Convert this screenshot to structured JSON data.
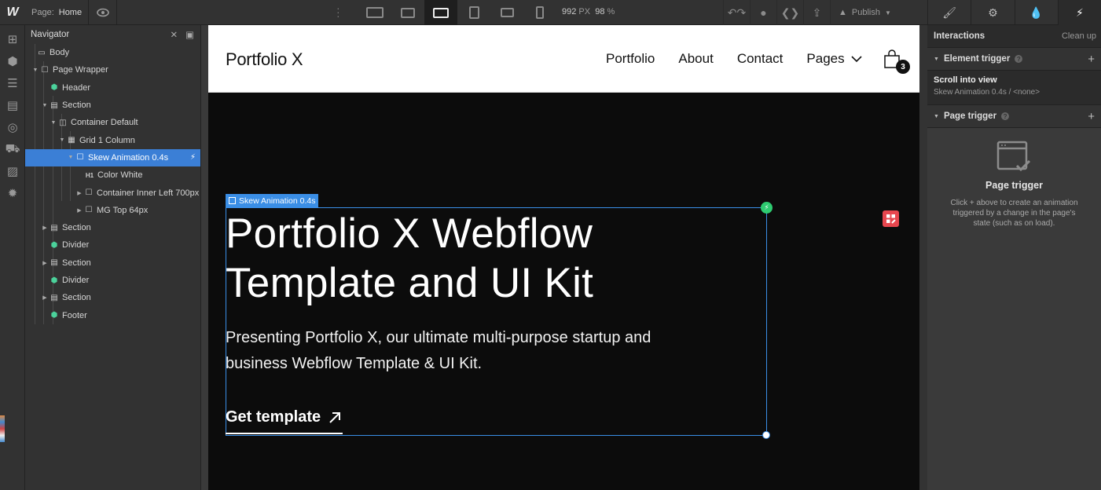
{
  "topbar": {
    "logo": "W",
    "page_label": "Page:",
    "page_name": "Home",
    "width_value": "992",
    "width_unit": "PX",
    "zoom_value": "98",
    "zoom_unit": "%",
    "publish_label": "Publish"
  },
  "navigator": {
    "title": "Navigator",
    "items": [
      {
        "label": "Body"
      },
      {
        "label": "Page Wrapper"
      },
      {
        "label": "Header"
      },
      {
        "label": "Section"
      },
      {
        "label": "Container Default"
      },
      {
        "label": "Grid 1 Column"
      },
      {
        "label": "Skew Animation 0.4s"
      },
      {
        "label": "Color White",
        "prefix": "H1"
      },
      {
        "label": "Container Inner Left 700px"
      },
      {
        "label": "MG Top 64px"
      },
      {
        "label": "Section"
      },
      {
        "label": "Divider"
      },
      {
        "label": "Section"
      },
      {
        "label": "Divider"
      },
      {
        "label": "Section"
      },
      {
        "label": "Footer"
      }
    ]
  },
  "canvas": {
    "brand": "Portfolio X",
    "menu": [
      "Portfolio",
      "About",
      "Contact",
      "Pages"
    ],
    "cart_count": "3",
    "selection_tag": "Skew Animation 0.4s",
    "hero_title": "Portfolio X Webflow Template and UI Kit",
    "hero_subtitle": "Presenting Portfolio X, our ultimate multi-purpose startup and business Webflow Template & UI Kit.",
    "cta": "Get template"
  },
  "interactions": {
    "title": "Interactions",
    "clean_up": "Clean up",
    "element_trigger": "Element trigger",
    "trigger_name": "Scroll into view",
    "trigger_detail": "Skew Animation 0.4s / <none>",
    "page_trigger": "Page trigger",
    "empty_title": "Page trigger",
    "empty_text": "Click + above to create an animation triggered by a change in the page's state (such as on load)."
  },
  "colors": {
    "selection": "#3b7fd6",
    "canvas_bg": "#0c0c0c",
    "accent_green": "#4bd29b"
  }
}
